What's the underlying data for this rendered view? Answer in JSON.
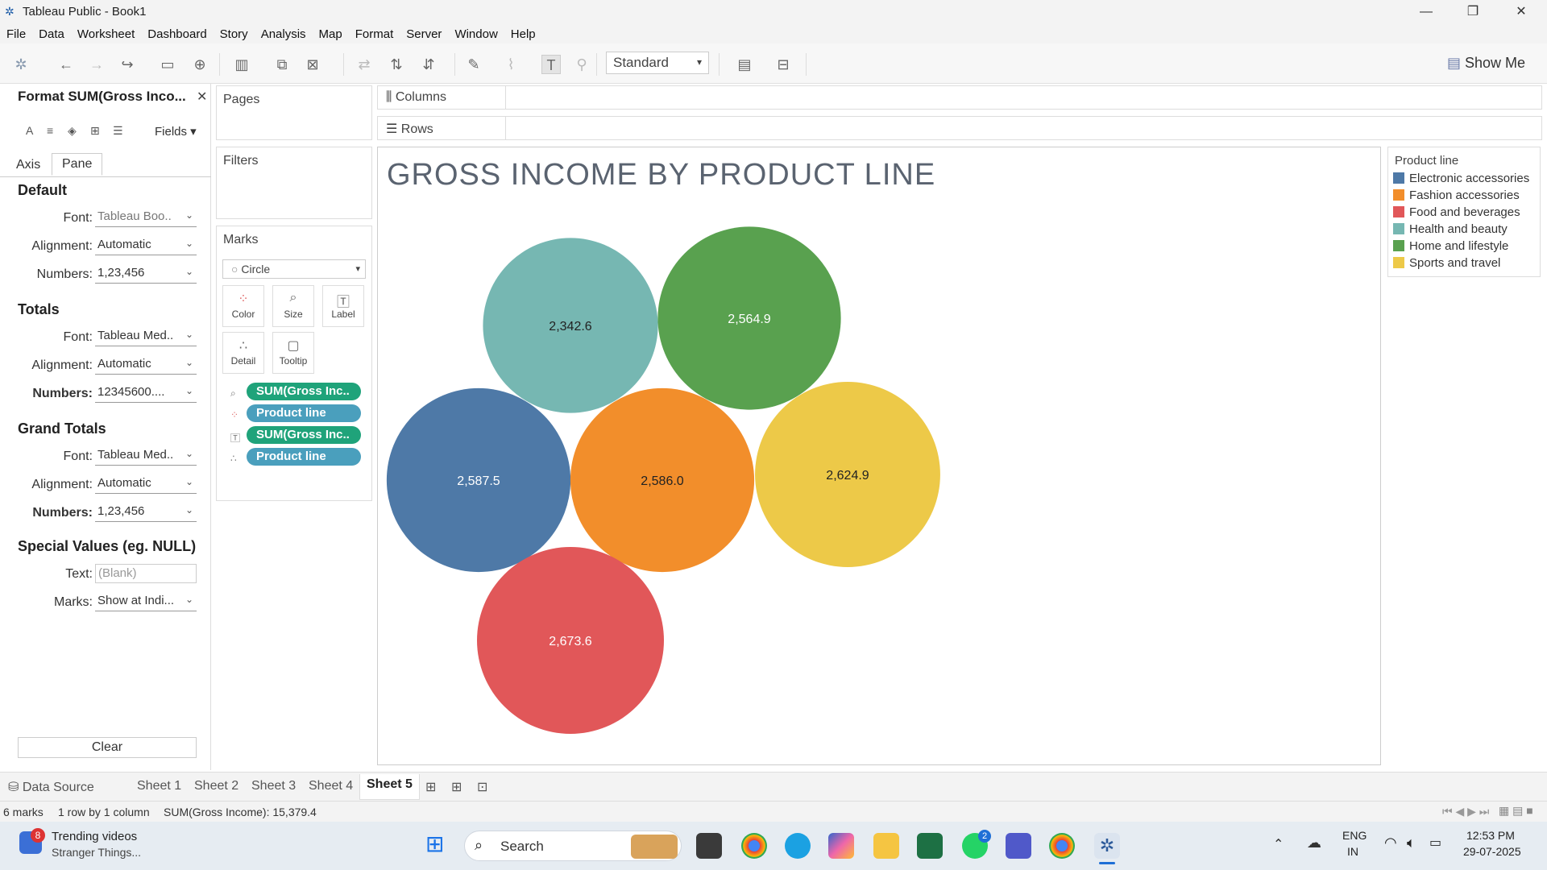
{
  "window": {
    "title": "Tableau Public - Book1"
  },
  "menu": [
    "File",
    "Data",
    "Worksheet",
    "Dashboard",
    "Story",
    "Analysis",
    "Map",
    "Format",
    "Server",
    "Window",
    "Help"
  ],
  "toolbar": {
    "fit": "Standard",
    "show_me": "Show Me"
  },
  "format_pane": {
    "title": "Format SUM(Gross Inco...",
    "fields_label": "Fields",
    "tabs": [
      "Axis",
      "Pane"
    ],
    "active_tab": "Pane",
    "default": {
      "heading": "Default",
      "font_label": "Font:",
      "font": "Tableau Boo..",
      "alignment_label": "Alignment:",
      "alignment": "Automatic",
      "numbers_label": "Numbers:",
      "numbers": "1,23,456"
    },
    "totals": {
      "heading": "Totals",
      "font_label": "Font:",
      "font": "Tableau Med..",
      "alignment_label": "Alignment:",
      "alignment": "Automatic",
      "numbers_label": "Numbers:",
      "numbers": "12345600...."
    },
    "grand_totals": {
      "heading": "Grand Totals",
      "font_label": "Font:",
      "font": "Tableau Med..",
      "alignment_label": "Alignment:",
      "alignment": "Automatic",
      "numbers_label": "Numbers:",
      "numbers": "1,23,456"
    },
    "special": {
      "heading": "Special Values (eg. NULL)",
      "text_label": "Text:",
      "text": "(Blank)",
      "marks_label": "Marks:",
      "marks": "Show at Indi..."
    },
    "clear": "Clear"
  },
  "cards": {
    "pages": "Pages",
    "filters": "Filters",
    "marks": "Marks",
    "mark_type": "Circle",
    "buttons": [
      "Color",
      "Size",
      "Label",
      "Detail",
      "Tooltip"
    ],
    "pills": [
      {
        "text": "SUM(Gross Inc..",
        "kind": "measure"
      },
      {
        "text": "Product line",
        "kind": "dimension"
      },
      {
        "text": "SUM(Gross Inc..",
        "kind": "measure"
      },
      {
        "text": "Product line",
        "kind": "dimension"
      }
    ]
  },
  "shelves": {
    "columns": "Columns",
    "rows": "Rows"
  },
  "viz": {
    "title": "GROSS INCOME BY PRODUCT LINE"
  },
  "chart_data": {
    "type": "bubble",
    "title": "GROSS INCOME BY PRODUCT LINE",
    "legend_title": "Product line",
    "legend_position": "right",
    "series": [
      {
        "name": "Electronic accessories",
        "value": 2587.5,
        "label": "2,587.5",
        "color": "#4e79a7"
      },
      {
        "name": "Fashion accessories",
        "value": 2586.0,
        "label": "2,586.0",
        "color": "#f28e2b"
      },
      {
        "name": "Food and beverages",
        "value": 2673.6,
        "label": "2,673.6",
        "color": "#e15759"
      },
      {
        "name": "Health and beauty",
        "value": 2342.6,
        "label": "2,342.6",
        "color": "#76b7b2"
      },
      {
        "name": "Home and lifestyle",
        "value": 2564.9,
        "label": "2,564.9",
        "color": "#59a14f"
      },
      {
        "name": "Sports and travel",
        "value": 2624.9,
        "label": "2,624.9",
        "color": "#edc948"
      }
    ]
  },
  "sheet_tabs": [
    "Data Source",
    "Sheet 1",
    "Sheet 2",
    "Sheet 3",
    "Sheet 4",
    "Sheet 5"
  ],
  "active_sheet": "Sheet 5",
  "status": {
    "marks": "6 marks",
    "rows": "1 row by 1 column",
    "sum": "SUM(Gross Income): 15,379.4"
  },
  "taskbar": {
    "news_title": "Trending videos",
    "news_sub": "Stranger Things...",
    "news_badge": "8",
    "search": "Search",
    "whatsapp_badge": "2",
    "lang1": "ENG",
    "lang2": "IN",
    "time": "12:53 PM",
    "date": "29-07-2025"
  }
}
